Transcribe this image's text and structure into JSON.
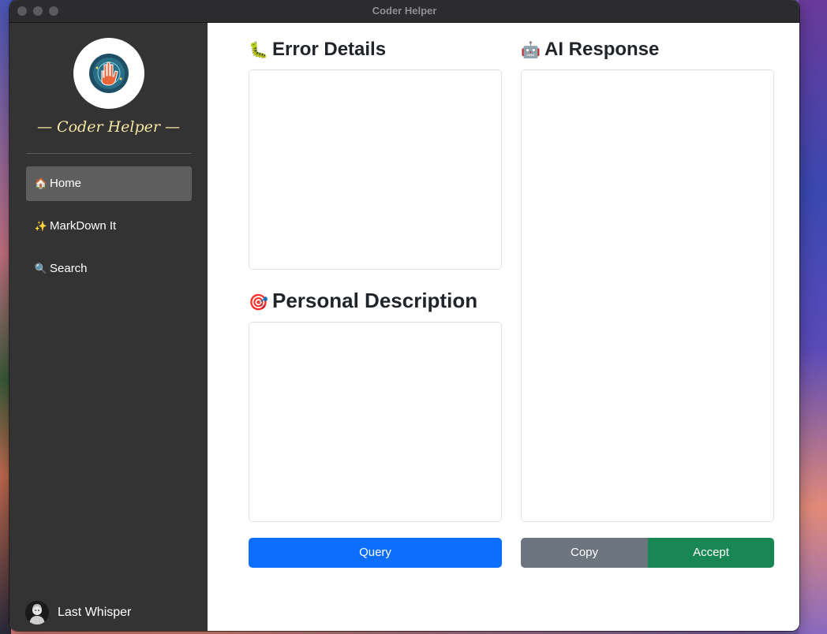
{
  "window": {
    "title": "Coder Helper"
  },
  "sidebar": {
    "brand": "— Coder Helper —",
    "items": [
      {
        "icon": "🏠",
        "icon_name": "house-icon",
        "label": "Home",
        "active": true
      },
      {
        "icon": "✨",
        "icon_name": "sparkles-icon",
        "label": "MarkDown It",
        "active": false
      },
      {
        "icon": "🔍",
        "icon_name": "magnifier-icon",
        "label": "Search",
        "active": false
      }
    ],
    "user": {
      "name": "Last Whisper"
    }
  },
  "main": {
    "error_details": {
      "icon": "🐛",
      "icon_name": "bug-icon",
      "title": "Error Details",
      "value": ""
    },
    "personal_description": {
      "icon": "🎯",
      "icon_name": "target-icon",
      "title": "Personal Description",
      "value": ""
    },
    "ai_response": {
      "icon": "🤖",
      "icon_name": "robot-icon",
      "title": "AI Response",
      "value": ""
    },
    "buttons": {
      "query": "Query",
      "copy": "Copy",
      "accept": "Accept"
    }
  },
  "colors": {
    "sidebar_bg": "#333333",
    "active_item_bg": "#5e5e5e",
    "brand_text": "#f5e6a3",
    "query_button": "#0d6efd",
    "copy_button": "#6c757d",
    "accept_button": "#198754"
  }
}
